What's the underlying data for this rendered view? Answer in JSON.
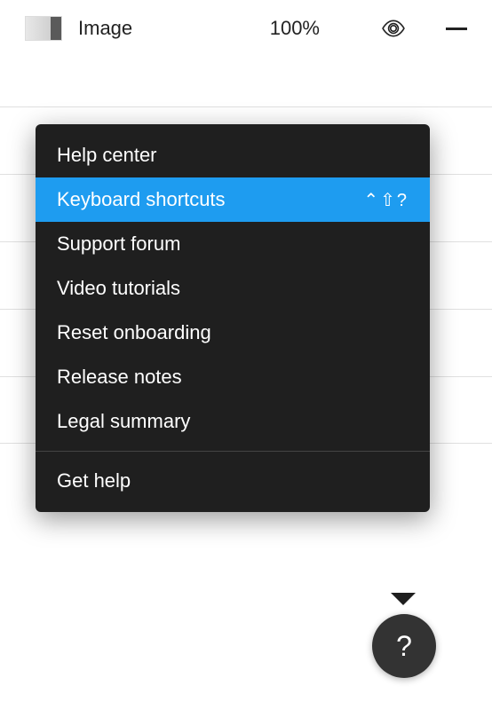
{
  "layer": {
    "name": "Image",
    "opacity": "100%"
  },
  "menu": {
    "items": [
      {
        "label": "Help center",
        "shortcut": ""
      },
      {
        "label": "Keyboard shortcuts",
        "shortcut": "⌃⇧?"
      },
      {
        "label": "Support forum",
        "shortcut": ""
      },
      {
        "label": "Video tutorials",
        "shortcut": ""
      },
      {
        "label": "Reset onboarding",
        "shortcut": ""
      },
      {
        "label": "Release notes",
        "shortcut": ""
      },
      {
        "label": "Legal summary",
        "shortcut": ""
      }
    ],
    "footerItem": {
      "label": "Get help"
    },
    "highlightedIndex": 1
  },
  "helpButton": {
    "label": "?"
  }
}
